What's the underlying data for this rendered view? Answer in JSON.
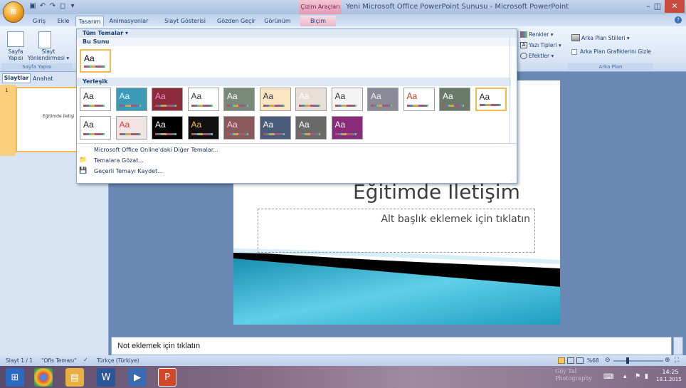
{
  "window": {
    "title": "Yeni Microsoft Office PowerPoint Sunusu - Microsoft PowerPoint",
    "context_tab": "Çizim Araçları",
    "qat_icons": [
      "save-icon",
      "undo-icon",
      "redo-icon",
      "new-icon"
    ]
  },
  "tabs": [
    "Giriş",
    "Ekle",
    "Tasarım",
    "Animasyonlar",
    "Slayt Gösterisi",
    "Gözden Geçir",
    "Görünüm",
    "Biçim"
  ],
  "ribbon": {
    "page_setup": {
      "sayfa": "Sayfa\nYapısı",
      "slayt": "Slayt\nYönlendirmesi ▾",
      "group": "Sayfa Yapısı"
    },
    "theme_opts": {
      "renkler": "Renkler ▾",
      "yazi_tipleri": "Yazı Tipleri ▾",
      "efektler": "Efektler ▾"
    },
    "background": {
      "styles": "Arka Plan Stilleri ▾",
      "hide": "Arka Plan Grafiklerini Gizle",
      "group": "Arka Plan"
    }
  },
  "gallery": {
    "header": "Tüm Temalar ▾",
    "section_current": "Bu Sunu",
    "section_builtin": "Yerleşik",
    "thumb_text": "Aa",
    "menu": [
      {
        "label": "Microsoft Office Online'daki Diğer Temalar...",
        "icon": ""
      },
      {
        "label": "Temalara Gözat...",
        "icon": "folder-icon"
      },
      {
        "label": "Geçerli Temayı Kaydet...",
        "icon": "save-theme-icon"
      }
    ]
  },
  "left_panel": {
    "tab_slides": "Slaytlar",
    "tab_outline": "Anahat",
    "thumb_num": "1",
    "thumb_title": "Eğitimde İletişi"
  },
  "slide": {
    "title": "Eğitimde İletişim",
    "subtitle": "Alt başlık eklemek için tıklatın"
  },
  "notes": "Not eklemek için tıklatın",
  "status": {
    "slide": "Slayt 1 / 1",
    "theme": "\"Ofis Teması\"",
    "lang": "Türkçe (Türkiye)",
    "zoom": "%68"
  },
  "taskbar": {
    "time": "14:25",
    "date": "18.1.2015",
    "watermark": "Göy Tal Photography"
  },
  "colors": {
    "ribbon": "#dbe7f6",
    "accent": "#f5b84c",
    "slide_wave": "#3bb5d3"
  }
}
